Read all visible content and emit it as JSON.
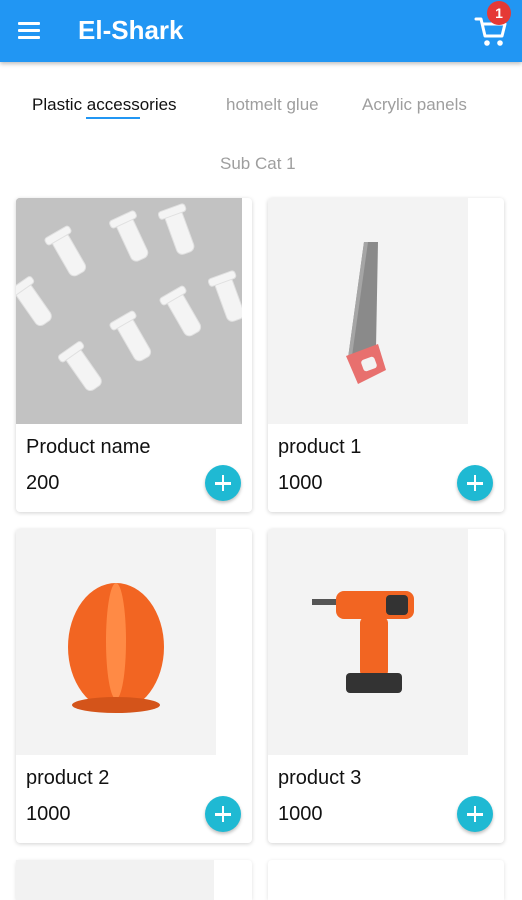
{
  "appbar": {
    "title": "El-Shark",
    "menu_icon": "menu-icon",
    "cart_icon": "cart-icon",
    "cart_count": "1",
    "color": "#2196F3"
  },
  "tabs": [
    {
      "label": "Plastic accessories",
      "active": true
    },
    {
      "label": "hotmelt glue",
      "active": false
    },
    {
      "label": "Acrylic panels",
      "active": false
    }
  ],
  "subcategory": "Sub Cat 1",
  "products": [
    {
      "name": "Product name",
      "price": "200",
      "image": "plastic-clips"
    },
    {
      "name": "product 1",
      "price": "1000",
      "image": "hand-saw"
    },
    {
      "name": "product 2",
      "price": "1000",
      "image": "hard-hat"
    },
    {
      "name": "product 3",
      "price": "1000",
      "image": "cordless-drill"
    }
  ],
  "add_button_color": "#1FB9D3"
}
